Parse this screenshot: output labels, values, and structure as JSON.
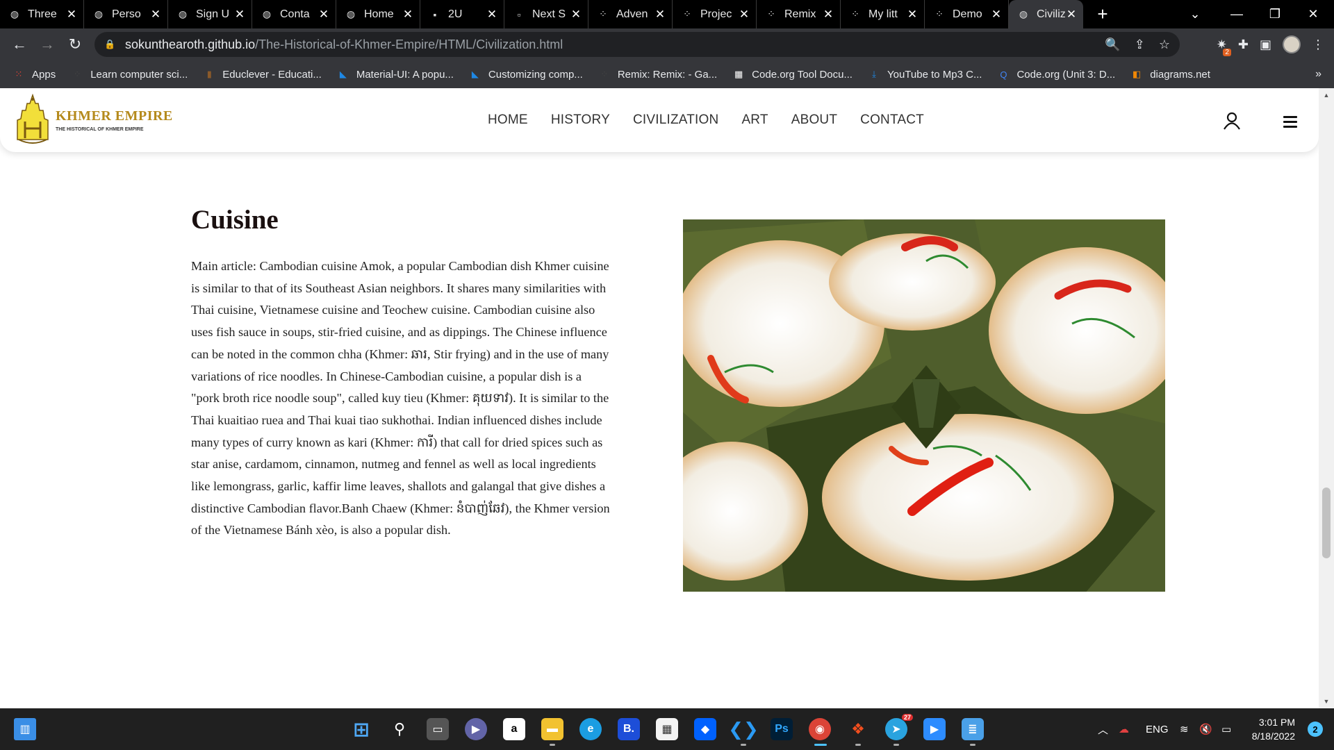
{
  "browser": {
    "tabs": [
      {
        "title": "Three",
        "icon": "globe-icon"
      },
      {
        "title": "Perso",
        "icon": "globe-icon"
      },
      {
        "title": "Sign U",
        "icon": "globe-icon"
      },
      {
        "title": "Conta",
        "icon": "globe-icon"
      },
      {
        "title": "Home",
        "icon": "globe-icon"
      },
      {
        "title": "2U",
        "icon": "page-icon"
      },
      {
        "title": "Next S",
        "icon": "next-icon"
      },
      {
        "title": "Adven",
        "icon": "dots-icon"
      },
      {
        "title": "Projec",
        "icon": "dots-icon"
      },
      {
        "title": "Remix",
        "icon": "dots-icon"
      },
      {
        "title": "My litt",
        "icon": "dots-icon"
      },
      {
        "title": "Demo",
        "icon": "dots-icon"
      },
      {
        "title": "Civiliz",
        "icon": "globe-icon",
        "active": true
      }
    ],
    "url_domain": "sokunthearoth.github.io",
    "url_path": "/The-Historical-of-Khmer-Empire/HTML/Civilization.html",
    "extension_badge": "2"
  },
  "bookmarks": [
    {
      "label": "Apps",
      "icon": "apps-grid-icon",
      "color": "#ea4335"
    },
    {
      "label": "Learn computer sci...",
      "icon": "dots-icon",
      "color": "#444444"
    },
    {
      "label": "Educlever - Educati...",
      "icon": "book-icon",
      "color": "#8a5a2a"
    },
    {
      "label": "Material-UI: A popu...",
      "icon": "mui-icon",
      "color": "#1e88e5"
    },
    {
      "label": "Customizing comp...",
      "icon": "mui-icon",
      "color": "#1e88e5"
    },
    {
      "label": "Remix: Remix: - Ga...",
      "icon": "dots-icon",
      "color": "#444444"
    },
    {
      "label": "Code.org Tool Docu...",
      "icon": "grid-icon",
      "color": "#ffffff"
    },
    {
      "label": "YouTube to Mp3 C...",
      "icon": "download-icon",
      "color": "#1e88e5"
    },
    {
      "label": "Code.org (Unit 3: D...",
      "icon": "q-icon",
      "color": "#4285f4"
    },
    {
      "label": "diagrams.net",
      "icon": "diagrams-icon",
      "color": "#f08705"
    }
  ],
  "site": {
    "logo_title": "KHMER EMPIRE",
    "logo_subtitle": "THE HISTORICAL OF KHMER EMPIRE",
    "nav": [
      "HOME",
      "HISTORY",
      "CIVILIZATION",
      "ART",
      "ABOUT",
      "CONTACT"
    ],
    "section_title": "Cuisine",
    "article": "Main article: Cambodian cuisine Amok, a popular Cambodian dish Khmer cuisine is similar to that of its Southeast Asian neighbors. It shares many similarities with Thai cuisine, Vietnamese cuisine and Teochew cuisine. Cambodian cuisine also uses fish sauce in soups, stir-fried cuisine, and as dippings. The Chinese influence can be noted in the common chha (Khmer: ឆារ, Stir frying) and in the use of many variations of rice noodles. In Chinese-Cambodian cuisine, a popular dish is a \"pork broth rice noodle soup\", called kuy tieu (Khmer: គុយទាវ). It is similar to the Thai kuaitiao ruea and Thai kuai tiao sukhothai. Indian influenced dishes include many types of curry known as kari (Khmer: ការី) that call for dried spices such as star anise, cardamom, cinnamon, nutmeg and fennel as well as local ingredients like lemongrass, garlic, kaffir lime leaves, shallots and galangal that give dishes a distinctive Cambodian flavor.Banh Chaew (Khmer: នំបាញ់ឆែវ), the Khmer version of the Vietnamese Bánh xèo, is also a popular dish."
  },
  "taskbar": {
    "language": "ENG",
    "time": "3:01 PM",
    "date": "8/18/2022",
    "notification_count": "2",
    "telegram_badge": "27"
  }
}
